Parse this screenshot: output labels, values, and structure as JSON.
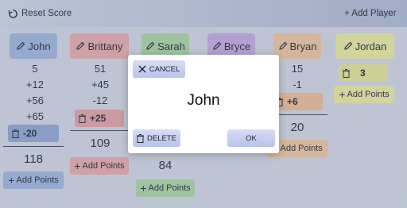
{
  "toolbar": {
    "reset_label": "Reset Score",
    "add_player_label": "+ Add Player"
  },
  "players": [
    {
      "name": "John",
      "color": "#9fb7df",
      "scores": [
        "5",
        "+12",
        "+56",
        "+65"
      ],
      "pending": "-20",
      "pending_color": "#8fa6d2",
      "total": "118"
    },
    {
      "name": "Brittany",
      "color": "#e8a9a9",
      "scores": [
        "51",
        "+45",
        "-12"
      ],
      "pending": "+25",
      "pending_color": "#e2a3a3",
      "total": "109"
    },
    {
      "name": "Sarah",
      "color": "#a9d6a0",
      "scores": [],
      "pending": "",
      "total": "84"
    },
    {
      "name": "Bryce",
      "color": "#c6a9e0",
      "scores": [],
      "pending": "",
      "total": ""
    },
    {
      "name": "Bryan",
      "color": "#f0c69e",
      "scores": [
        "15",
        "-1"
      ],
      "pending": "+6",
      "pending_color": "#efbd95",
      "total": "20"
    },
    {
      "name": "Jordan",
      "color": "#ecec9e",
      "scores": [],
      "pending": "3",
      "pending_color": "#e6e695",
      "total": ""
    }
  ],
  "add_points_label": "Add Points",
  "dialog": {
    "cancel_label": "CANCEL",
    "player_name": "John",
    "delete_label": "DELETE",
    "ok_label": "OK"
  }
}
